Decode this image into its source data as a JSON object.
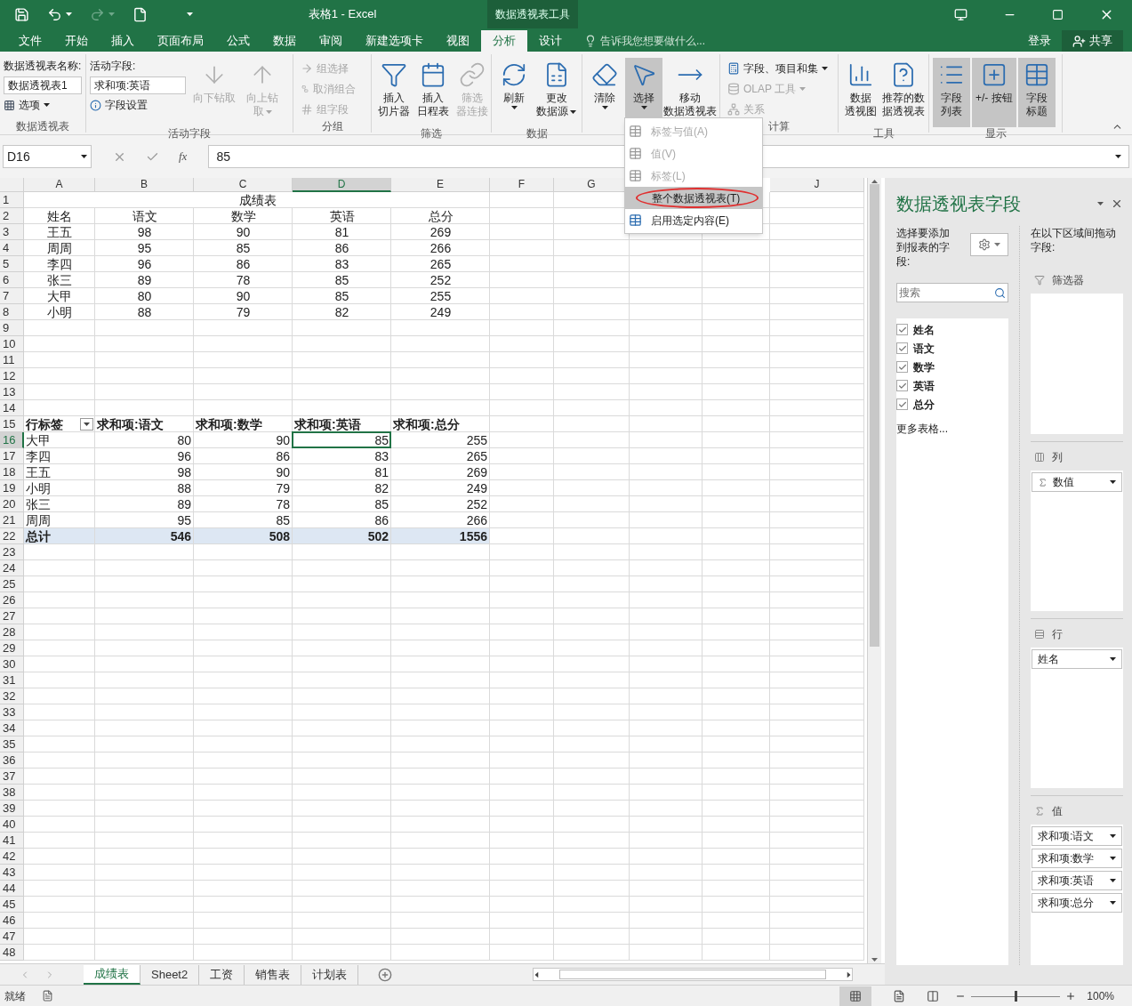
{
  "title_bar": {
    "title": "表格1 - Excel",
    "context_tab": "数据透视表工具"
  },
  "menu_tabs": [
    {
      "label": "文件",
      "selected": false
    },
    {
      "label": "开始",
      "selected": false
    },
    {
      "label": "插入",
      "selected": false
    },
    {
      "label": "页面布局",
      "selected": false
    },
    {
      "label": "公式",
      "selected": false
    },
    {
      "label": "数据",
      "selected": false
    },
    {
      "label": "审阅",
      "selected": false
    },
    {
      "label": "新建选项卡",
      "selected": false
    },
    {
      "label": "视图",
      "selected": false
    },
    {
      "label": "分析",
      "selected": true
    },
    {
      "label": "设计",
      "selected": false
    }
  ],
  "tell_me": {
    "placeholder": "告诉我您想要做什么..."
  },
  "sign_in": "登录",
  "share": "共享",
  "ribbon": {
    "groups": [
      {
        "kind": "pivot",
        "label": "数据透视表",
        "name_label": "数据透视表名称:",
        "name_value": "数据透视表1",
        "options": "选项"
      },
      {
        "kind": "active_field",
        "label": "活动字段",
        "field_label": "活动字段:",
        "field_value": "求和项:英语",
        "settings": "字段设置",
        "buttons": [
          {
            "lines": [
              "向下钻取"
            ],
            "disabled": true,
            "dropdown": false
          },
          {
            "lines": [
              "向上钻",
              "取"
            ],
            "disabled": true,
            "dropdown": true
          }
        ]
      },
      {
        "kind": "small",
        "label": "分组",
        "items": [
          {
            "label": "组选择",
            "disabled": true,
            "dropdown": false
          },
          {
            "label": "取消组合",
            "disabled": true,
            "dropdown": false
          },
          {
            "label": "组字段",
            "disabled": true,
            "dropdown": false
          }
        ]
      },
      {
        "kind": "large",
        "label": "筛选",
        "buttons": [
          {
            "lines": [
              "插入",
              "切片器"
            ],
            "disabled": false,
            "dropdown": false,
            "selected": false
          },
          {
            "lines": [
              "插入",
              "日程表"
            ],
            "disabled": false,
            "dropdown": false,
            "selected": false
          },
          {
            "lines": [
              "筛选",
              "器连接"
            ],
            "disabled": true,
            "dropdown": false,
            "selected": false
          }
        ]
      },
      {
        "kind": "large",
        "label": "数据",
        "buttons": [
          {
            "lines": [
              "刷新"
            ],
            "disabled": false,
            "dropdown": true,
            "selected": false
          },
          {
            "lines": [
              "更改",
              "数据源"
            ],
            "disabled": false,
            "dropdown": true,
            "selected": false
          }
        ]
      },
      {
        "kind": "large",
        "buttons": [
          {
            "lines": [
              "清除"
            ],
            "disabled": false,
            "dropdown": true,
            "selected": false
          },
          {
            "lines": [
              "选择"
            ],
            "disabled": false,
            "dropdown": true,
            "selected": true
          },
          {
            "lines": [
              "移动",
              "数据透视表"
            ],
            "disabled": false,
            "dropdown": false,
            "selected": false
          }
        ]
      },
      {
        "kind": "small",
        "label": "计算",
        "items": [
          {
            "label": "字段、项目和集",
            "disabled": false,
            "dropdown": true
          },
          {
            "label": "OLAP 工具",
            "disabled": true,
            "dropdown": true
          },
          {
            "label": "关系",
            "disabled": true,
            "dropdown": false
          }
        ]
      },
      {
        "kind": "large",
        "label": "工具",
        "buttons": [
          {
            "lines": [
              "数据",
              "透视图"
            ],
            "disabled": false,
            "dropdown": false,
            "selected": false
          },
          {
            "lines": [
              "推荐的数",
              "据透视表"
            ],
            "disabled": false,
            "dropdown": false,
            "selected": false
          }
        ]
      },
      {
        "kind": "large",
        "label": "显示",
        "buttons": [
          {
            "lines": [
              "字段",
              "列表"
            ],
            "disabled": false,
            "dropdown": false,
            "selected": true
          },
          {
            "lines": [
              "+/- 按钮"
            ],
            "disabled": false,
            "dropdown": false,
            "selected": true
          },
          {
            "lines": [
              "字段",
              "标题"
            ],
            "disabled": false,
            "dropdown": false,
            "selected": true
          }
        ]
      }
    ]
  },
  "select_menu": [
    {
      "label": "标签与值(A)",
      "disabled": true,
      "selected": false
    },
    {
      "label": "值(V)",
      "disabled": true,
      "selected": false
    },
    {
      "label": "标签(L)",
      "disabled": true,
      "selected": false
    },
    {
      "label": "整个数据透视表(T)",
      "disabled": false,
      "selected": true
    },
    {
      "label": "启用选定内容(E)",
      "disabled": false,
      "selected": false
    }
  ],
  "formula_bar": {
    "name_box": "D16",
    "function_label": "fx",
    "value": "85"
  },
  "sheet": {
    "columns": [
      {
        "label": "A",
        "selected": false
      },
      {
        "label": "B",
        "selected": false
      },
      {
        "label": "C",
        "selected": false
      },
      {
        "label": "D",
        "selected": true
      },
      {
        "label": "E",
        "selected": false
      },
      {
        "label": "F",
        "selected": false
      },
      {
        "label": "G",
        "selected": false
      },
      {
        "label": "J",
        "selected": false
      }
    ],
    "rows": [
      {
        "number": "1",
        "selected": false,
        "kind": "title",
        "cells": {
          "A": "成绩表"
        }
      },
      {
        "number": "2",
        "selected": false,
        "kind": "data",
        "cells": {
          "A": "姓名",
          "B": "语文",
          "C": "数学",
          "D": "英语",
          "E": "总分"
        }
      },
      {
        "number": "3",
        "selected": false,
        "kind": "data",
        "cells": {
          "A": "王五",
          "B": "98",
          "C": "90",
          "D": "81",
          "E": "269"
        }
      },
      {
        "number": "4",
        "selected": false,
        "kind": "data",
        "cells": {
          "A": "周周",
          "B": "95",
          "C": "85",
          "D": "86",
          "E": "266"
        }
      },
      {
        "number": "5",
        "selected": false,
        "kind": "data",
        "cells": {
          "A": "李四",
          "B": "96",
          "C": "86",
          "D": "83",
          "E": "265"
        }
      },
      {
        "number": "6",
        "selected": false,
        "kind": "data",
        "cells": {
          "A": "张三",
          "B": "89",
          "C": "78",
          "D": "85",
          "E": "252"
        }
      },
      {
        "number": "7",
        "selected": false,
        "kind": "data",
        "cells": {
          "A": "大甲",
          "B": "80",
          "C": "90",
          "D": "85",
          "E": "255"
        }
      },
      {
        "number": "8",
        "selected": false,
        "kind": "data",
        "cells": {
          "A": "小明",
          "B": "88",
          "C": "79",
          "D": "82",
          "E": "249"
        }
      },
      {
        "number": "9",
        "selected": false,
        "kind": "empty"
      },
      {
        "number": "10",
        "selected": false,
        "kind": "empty"
      },
      {
        "number": "11",
        "selected": false,
        "kind": "empty"
      },
      {
        "number": "12",
        "selected": false,
        "kind": "empty"
      },
      {
        "number": "13",
        "selected": false,
        "kind": "empty"
      },
      {
        "number": "14",
        "selected": false,
        "kind": "empty"
      },
      {
        "number": "15",
        "selected": false,
        "kind": "pivot_header",
        "cells": {
          "A": "行标签",
          "B": "求和项:语文",
          "C": "求和项:数学",
          "D": "求和项:英语",
          "E": "求和项:总分"
        }
      },
      {
        "number": "16",
        "selected": true,
        "kind": "pivot",
        "cells": {
          "A": "大甲",
          "B": "80",
          "C": "90",
          "D": "85",
          "E": "255"
        }
      },
      {
        "number": "17",
        "selected": false,
        "kind": "pivot",
        "cells": {
          "A": "李四",
          "B": "96",
          "C": "86",
          "D": "83",
          "E": "265"
        }
      },
      {
        "number": "18",
        "selected": false,
        "kind": "pivot",
        "cells": {
          "A": "王五",
          "B": "98",
          "C": "90",
          "D": "81",
          "E": "269"
        }
      },
      {
        "number": "19",
        "selected": false,
        "kind": "pivot",
        "cells": {
          "A": "小明",
          "B": "88",
          "C": "79",
          "D": "82",
          "E": "249"
        }
      },
      {
        "number": "20",
        "selected": false,
        "kind": "pivot",
        "cells": {
          "A": "张三",
          "B": "89",
          "C": "78",
          "D": "85",
          "E": "252"
        }
      },
      {
        "number": "21",
        "selected": false,
        "kind": "pivot",
        "cells": {
          "A": "周周",
          "B": "95",
          "C": "85",
          "D": "86",
          "E": "266"
        }
      },
      {
        "number": "22",
        "selected": false,
        "kind": "total",
        "cells": {
          "A": "总计",
          "B": "546",
          "C": "508",
          "D": "502",
          "E": "1556"
        }
      },
      {
        "number": "23",
        "selected": false,
        "kind": "empty"
      },
      {
        "number": "24",
        "selected": false,
        "kind": "empty"
      },
      {
        "number": "25",
        "selected": false,
        "kind": "empty"
      },
      {
        "number": "26",
        "selected": false,
        "kind": "empty"
      },
      {
        "number": "27",
        "selected": false,
        "kind": "empty"
      },
      {
        "number": "28",
        "selected": false,
        "kind": "empty"
      },
      {
        "number": "29",
        "selected": false,
        "kind": "empty"
      },
      {
        "number": "30",
        "selected": false,
        "kind": "empty"
      },
      {
        "number": "31",
        "selected": false,
        "kind": "empty"
      },
      {
        "number": "32",
        "selected": false,
        "kind": "empty"
      },
      {
        "number": "33",
        "selected": false,
        "kind": "empty"
      },
      {
        "number": "34",
        "selected": false,
        "kind": "empty"
      },
      {
        "number": "35",
        "selected": false,
        "kind": "empty"
      },
      {
        "number": "36",
        "selected": false,
        "kind": "empty"
      },
      {
        "number": "37",
        "selected": false,
        "kind": "empty"
      },
      {
        "number": "38",
        "selected": false,
        "kind": "empty"
      },
      {
        "number": "39",
        "selected": false,
        "kind": "empty"
      },
      {
        "number": "40",
        "selected": false,
        "kind": "empty"
      },
      {
        "number": "41",
        "selected": false,
        "kind": "empty"
      },
      {
        "number": "42",
        "selected": false,
        "kind": "empty"
      },
      {
        "number": "43",
        "selected": false,
        "kind": "empty"
      },
      {
        "number": "44",
        "selected": false,
        "kind": "empty"
      },
      {
        "number": "45",
        "selected": false,
        "kind": "empty"
      },
      {
        "number": "46",
        "selected": false,
        "kind": "empty"
      },
      {
        "number": "47",
        "selected": false,
        "kind": "empty"
      },
      {
        "number": "48",
        "selected": false,
        "kind": "empty"
      }
    ]
  },
  "field_pane": {
    "title": "数据透视表字段",
    "instruction": "选择要添加到报表的字段:",
    "search": {
      "placeholder": "搜索"
    },
    "fields": [
      {
        "label": "姓名",
        "checked": true
      },
      {
        "label": "语文",
        "checked": true
      },
      {
        "label": "数学",
        "checked": true
      },
      {
        "label": "英语",
        "checked": true
      },
      {
        "label": "总分",
        "checked": true
      }
    ],
    "more_tables": "更多表格...",
    "drag_hint": "在以下区域间拖动字段:",
    "areas": [
      {
        "kind": "filters",
        "label": "筛选器"
      },
      {
        "kind": "columns",
        "label": "列",
        "items": [
          {
            "label": "数值",
            "kind": "values"
          }
        ]
      },
      {
        "kind": "rows",
        "label": "行",
        "items": [
          {
            "label": "姓名",
            "kind": "field"
          }
        ]
      },
      {
        "kind": "values",
        "label": "值",
        "items": [
          {
            "label": "求和项:语文",
            "kind": "field"
          },
          {
            "label": "求和项:数学",
            "kind": "field"
          },
          {
            "label": "求和项:英语",
            "kind": "field"
          },
          {
            "label": "求和项:总分",
            "kind": "field"
          }
        ]
      }
    ]
  },
  "sheet_tabs": [
    {
      "label": "成绩表",
      "selected": true
    },
    {
      "label": "Sheet2",
      "selected": false
    },
    {
      "label": "工资",
      "selected": false
    },
    {
      "label": "销售表",
      "selected": false
    },
    {
      "label": "计划表",
      "selected": false
    }
  ],
  "status_bar": {
    "status": "就绪",
    "zoom": "100%",
    "level": 0.5
  }
}
